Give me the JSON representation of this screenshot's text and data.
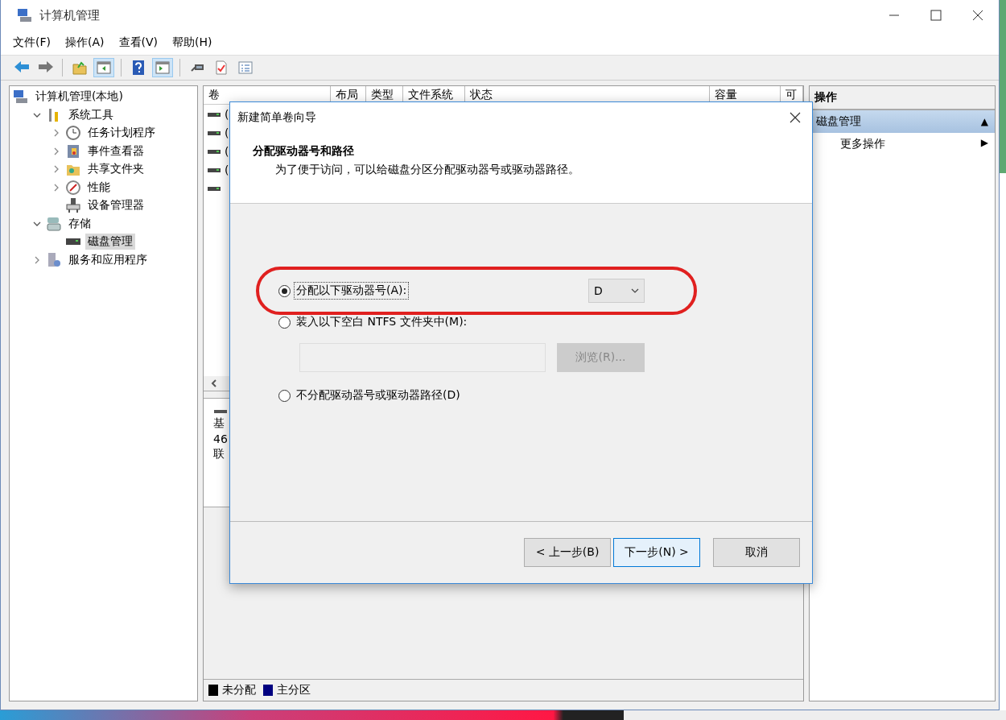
{
  "window": {
    "title": "计算机管理"
  },
  "menu": [
    "文件(F)",
    "操作(A)",
    "查看(V)",
    "帮助(H)"
  ],
  "toolbar": [
    {
      "kind": "back",
      "pressed": false
    },
    {
      "kind": "forward",
      "pressed": false
    },
    {
      "kind": "up",
      "pressed": false
    },
    {
      "kind": "pane",
      "pressed": true
    },
    {
      "kind": "help",
      "pressed": false
    },
    {
      "kind": "pane2",
      "pressed": true
    },
    {
      "kind": "connect",
      "pressed": false
    },
    {
      "kind": "check",
      "pressed": false
    },
    {
      "kind": "list",
      "pressed": false
    }
  ],
  "tree": [
    {
      "label": "计算机管理(本地)",
      "kind": "computer",
      "selected": false,
      "children": [
        {
          "label": "系统工具",
          "kind": "tools",
          "selected": false,
          "expanded": true,
          "children": [
            {
              "label": "任务计划程序",
              "kind": "clock",
              "selected": false,
              "expanded": false
            },
            {
              "label": "事件查看器",
              "kind": "event",
              "selected": false,
              "expanded": false
            },
            {
              "label": "共享文件夹",
              "kind": "share",
              "selected": false,
              "expanded": false
            },
            {
              "label": "性能",
              "kind": "perf",
              "selected": false,
              "expanded": false
            },
            {
              "label": "设备管理器",
              "kind": "device",
              "selected": false
            }
          ]
        },
        {
          "label": "存储",
          "kind": "storage",
          "selected": false,
          "expanded": true,
          "children": [
            {
              "label": "磁盘管理",
              "kind": "disk",
              "selected": true
            }
          ]
        },
        {
          "label": "服务和应用程序",
          "kind": "services",
          "selected": false,
          "expanded": false
        }
      ]
    }
  ],
  "volumes": {
    "columns": [
      "卷",
      "布局",
      "类型",
      "文件系统",
      "状态",
      "容量",
      "可"
    ],
    "rows": [
      {
        "text": "("
      },
      {
        "text": "("
      },
      {
        "text": "("
      },
      {
        "text": "("
      },
      {}
    ]
  },
  "disk_pane": {
    "lines": [
      "基",
      "46",
      "联"
    ]
  },
  "legend": [
    {
      "label": "未分配",
      "color": "#000000"
    },
    {
      "label": "主分区",
      "color": "#000080"
    }
  ],
  "actions": {
    "title": "操作",
    "section": {
      "label": "磁盘管理",
      "toggle": "▲"
    },
    "items": [
      {
        "label": "更多操作",
        "arrow": "▶"
      }
    ]
  },
  "dialog": {
    "title": "新建简单卷向导",
    "heading": "分配驱动器号和路径",
    "subtitle": "为了便于访问，可以给磁盘分区分配驱动器号或驱动器路径。",
    "options": [
      {
        "kind": "letter",
        "label": "分配以下驱动器号(A):",
        "selected": true,
        "value": "D"
      },
      {
        "kind": "folder",
        "label": "装入以下空白 NTFS 文件夹中(M):",
        "selected": false,
        "browse": "浏览(R)...",
        "disabled": true
      },
      {
        "kind": "none",
        "label": "不分配驱动器号或驱动器路径(D)",
        "selected": false
      }
    ],
    "buttons": [
      {
        "label": "< 上一步(B)",
        "focused": false
      },
      {
        "label": "下一步(N) >",
        "focused": true
      },
      {
        "label": "取消",
        "focused": false
      }
    ]
  }
}
